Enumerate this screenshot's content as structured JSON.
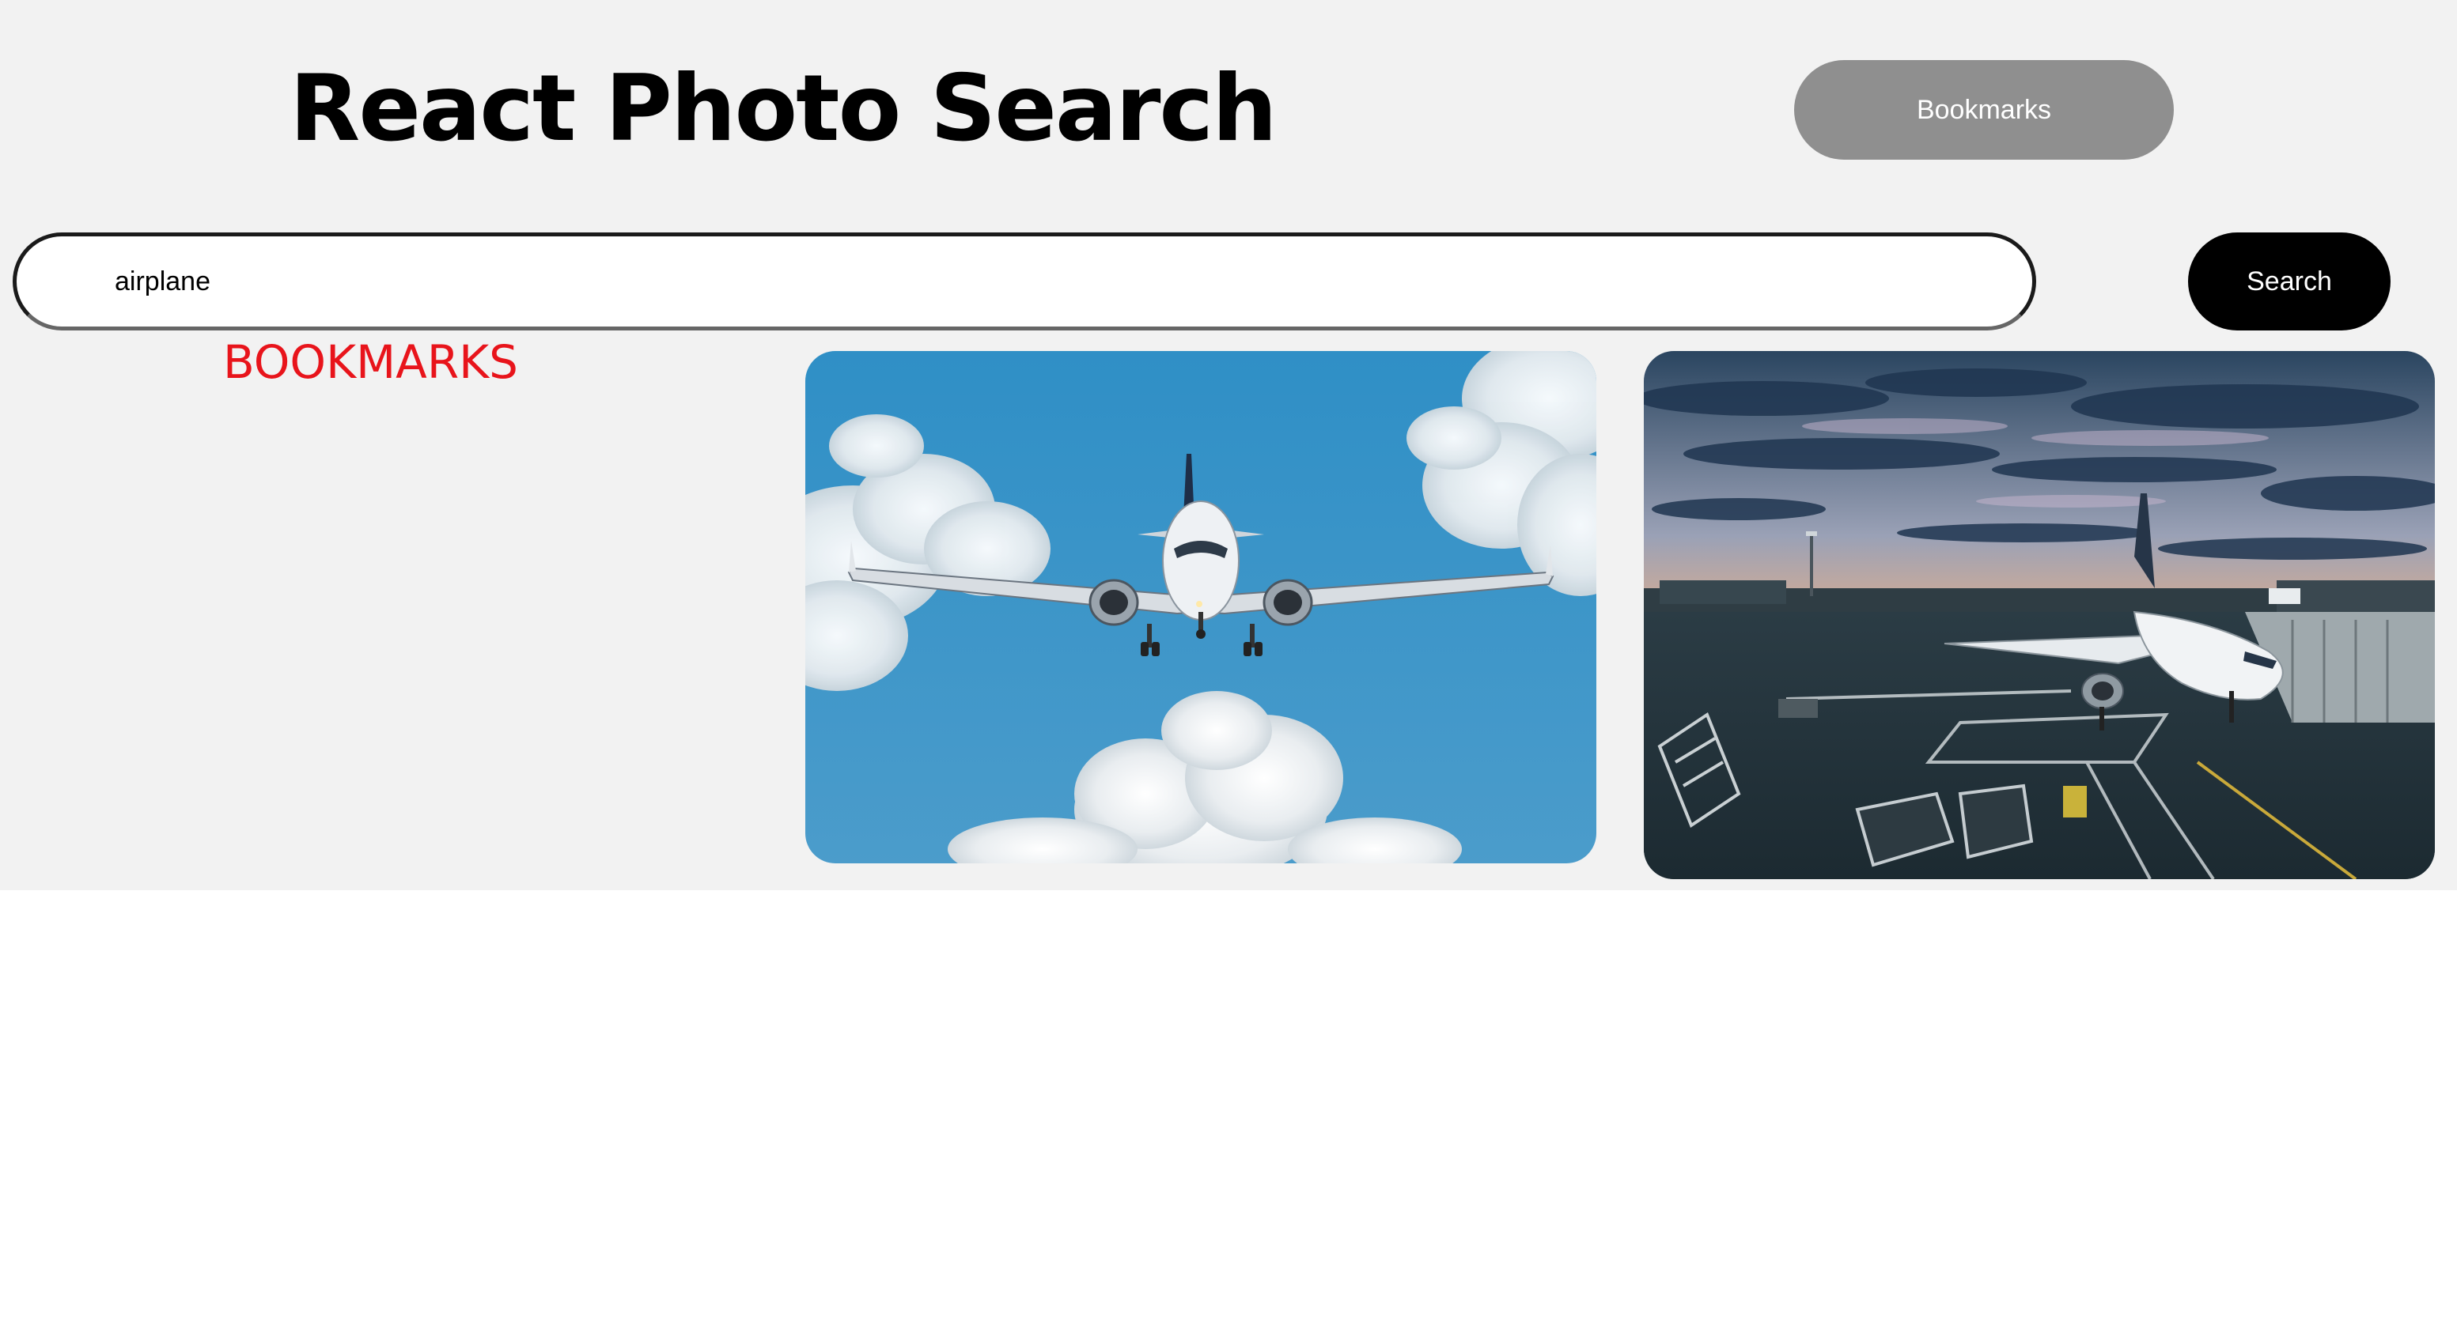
{
  "header": {
    "title": "React Photo Search",
    "bookmarks_button_label": "Bookmarks"
  },
  "search": {
    "value": "airplane",
    "button_label": "Search"
  },
  "sidebar": {
    "heading": "BOOKMARKS"
  },
  "results": [
    {
      "subject": "airplane-in-flight-sky"
    },
    {
      "subject": "airplane-at-airport-gate-sunset"
    }
  ],
  "colors": {
    "background": "#f2f2f2",
    "bookmarks_button": "#8f8f8f",
    "search_button": "#000000",
    "heading_accent": "#e8141b"
  }
}
